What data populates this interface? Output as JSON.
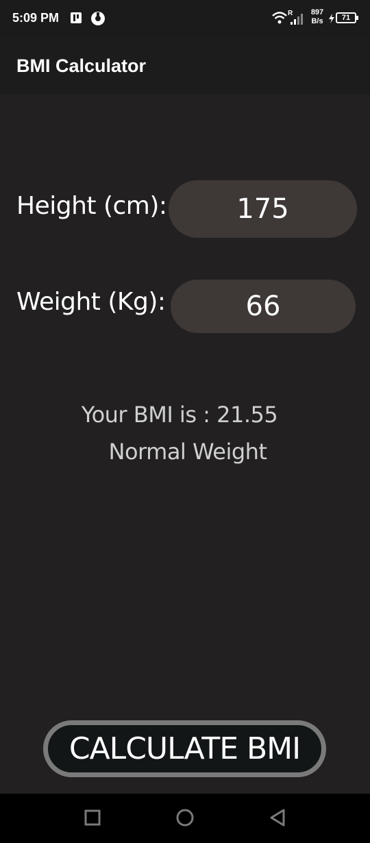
{
  "status_bar": {
    "time": "5:09 PM",
    "network_speed_value": "897",
    "network_speed_unit": "B/s",
    "signal_label": "R",
    "battery": "71",
    "icons": [
      "p-icon",
      "o-icon",
      "wifi-icon",
      "signal-icon",
      "charging-bolt-icon",
      "battery-icon"
    ]
  },
  "app_bar": {
    "title": "BMI Calculator"
  },
  "form": {
    "height_label": "Height (cm):",
    "height_value": "175",
    "weight_label": "Weight (Kg):",
    "weight_value": "66"
  },
  "result": {
    "bmi_text": "Your BMI is : 21.55",
    "category": "Normal Weight"
  },
  "actions": {
    "calculate_label": "CALCULATE BMI"
  },
  "nav_bar": {
    "icons": [
      "recents-icon",
      "home-icon",
      "back-icon"
    ]
  },
  "colors": {
    "background": "#222021",
    "app_bar": "#1c1c1c",
    "input_fill": "#3e3837",
    "button_fill": "#121617",
    "button_border": "#7a7a7a",
    "result_text": "#d0d0d0"
  }
}
